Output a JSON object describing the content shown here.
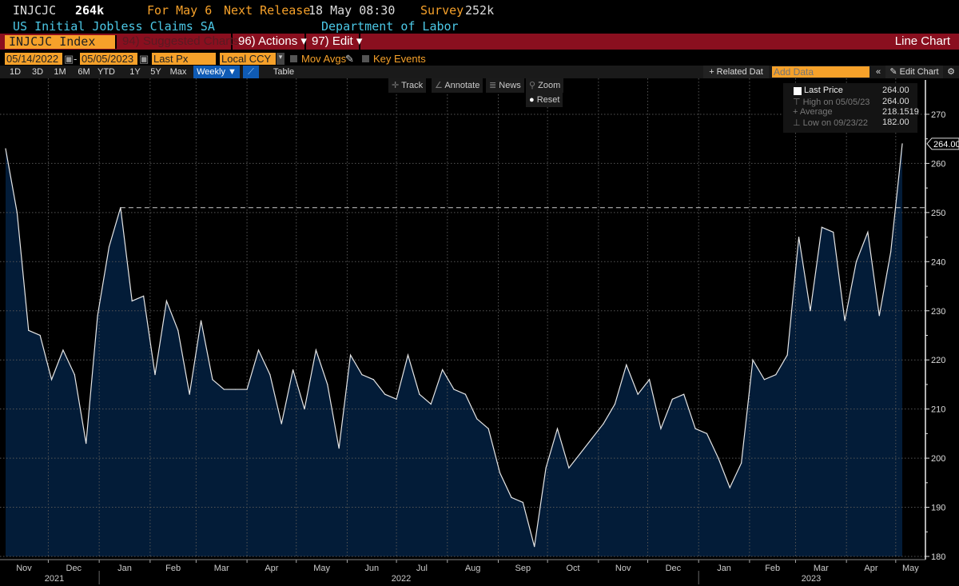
{
  "header": {
    "ticker": "INJCJC",
    "value": "264k",
    "for_label": "For May 6",
    "next_release_label": "Next Release",
    "next_release": "18 May 08:30",
    "survey_label": "Survey",
    "survey": "252k",
    "title": "US Initial Jobless Claims SA",
    "source": "Department of Labor"
  },
  "menu": {
    "security": "INJCJC Index",
    "suggested": "94) Suggested Charts",
    "actions": "96) Actions ▾",
    "edit": "97) Edit ▾",
    "chart_type": "Line Chart"
  },
  "controls": {
    "start_date": "05/14/2022",
    "end_date": "05/05/2023",
    "field": "Last Px",
    "currency": "Local CCY",
    "mov_avgs": "Mov Avgs",
    "key_events": "Key Events"
  },
  "ranges": [
    "1D",
    "3D",
    "1M",
    "6M",
    "YTD",
    "1Y",
    "5Y",
    "Max"
  ],
  "frequency": "Weekly ▼",
  "table_label": "Table",
  "right_tools": {
    "related": "+ Related Dat",
    "add_data_placeholder": "Add Data",
    "collapse": "«",
    "edit_chart": "✎ Edit Chart",
    "settings_icon": "gear-icon"
  },
  "tools": {
    "track": "Track",
    "annotate": "Annotate",
    "news": "News",
    "zoom": "Zoom",
    "reset": "Reset"
  },
  "legend": {
    "last_label": "Last Price",
    "last": "264.00",
    "high_label": "High on 05/05/23",
    "high": "264.00",
    "avg_label": "Average",
    "avg": "218.1519",
    "low_label": "Low on 09/23/22",
    "low": "182.00"
  },
  "colors": {
    "orange": "#f6a12a",
    "menu_red": "#8a0f1f",
    "cyan": "#4cc8e6",
    "area_fill": "#031c38",
    "line": "#e6e6e6"
  },
  "chart_data": {
    "type": "area",
    "ylim": [
      180,
      270
    ],
    "yticks": [
      180,
      190,
      200,
      210,
      220,
      230,
      240,
      250,
      260,
      270
    ],
    "grid": true,
    "last_value_label": "264.00",
    "reference_line": 251,
    "month_labels": [
      "Nov",
      "Dec",
      "Jan",
      "Feb",
      "Mar",
      "Apr",
      "May",
      "Jun",
      "Jul",
      "Aug",
      "Sep",
      "Oct",
      "Nov",
      "Dec",
      "Jan",
      "Feb",
      "Mar",
      "Apr",
      "May"
    ],
    "year_labels": [
      "2021",
      "2022",
      "2023"
    ],
    "x": [
      "2021-11-05",
      "2021-11-12",
      "2021-11-19",
      "2021-11-26",
      "2021-12-03",
      "2021-12-10",
      "2021-12-17",
      "2021-12-24",
      "2021-12-31",
      "2022-01-07",
      "2022-01-14",
      "2022-01-21",
      "2022-01-28",
      "2022-02-04",
      "2022-02-11",
      "2022-02-18",
      "2022-02-25",
      "2022-03-04",
      "2022-03-11",
      "2022-03-18",
      "2022-03-25",
      "2022-04-01",
      "2022-04-08",
      "2022-04-15",
      "2022-04-22",
      "2022-04-29",
      "2022-05-06",
      "2022-05-13",
      "2022-05-20",
      "2022-05-27",
      "2022-06-03",
      "2022-06-10",
      "2022-06-17",
      "2022-06-24",
      "2022-07-01",
      "2022-07-08",
      "2022-07-15",
      "2022-07-22",
      "2022-07-29",
      "2022-08-05",
      "2022-08-12",
      "2022-08-19",
      "2022-08-26",
      "2022-09-02",
      "2022-09-09",
      "2022-09-16",
      "2022-09-23",
      "2022-09-30",
      "2022-10-07",
      "2022-10-14",
      "2022-10-21",
      "2022-10-28",
      "2022-11-04",
      "2022-11-11",
      "2022-11-18",
      "2022-11-25",
      "2022-12-02",
      "2022-12-09",
      "2022-12-16",
      "2022-12-23",
      "2022-12-30",
      "2023-01-06",
      "2023-01-13",
      "2023-01-20",
      "2023-01-27",
      "2023-02-03",
      "2023-02-10",
      "2023-02-17",
      "2023-02-24",
      "2023-03-03",
      "2023-03-10",
      "2023-03-17",
      "2023-03-24",
      "2023-03-31",
      "2023-04-07",
      "2023-04-14",
      "2023-04-21",
      "2023-04-28",
      "2023-05-05"
    ],
    "series": [
      {
        "name": "Last Price",
        "values": [
          263,
          250,
          226,
          225,
          216,
          222,
          217,
          203,
          229,
          243,
          251,
          232,
          233,
          217,
          232,
          226,
          213,
          228,
          216,
          214,
          214,
          214,
          222,
          217,
          207,
          218,
          210,
          222,
          215,
          202,
          221,
          217,
          216,
          213,
          212,
          221,
          213,
          211,
          218,
          214,
          213,
          208,
          206,
          197,
          192,
          191,
          182,
          198,
          206,
          198,
          201,
          204,
          207,
          211,
          219,
          213,
          216,
          206,
          212,
          213,
          206,
          205,
          200,
          194,
          199,
          220,
          216,
          217,
          221,
          245,
          230,
          247,
          246,
          228,
          240,
          246,
          229,
          242,
          264
        ]
      }
    ]
  }
}
